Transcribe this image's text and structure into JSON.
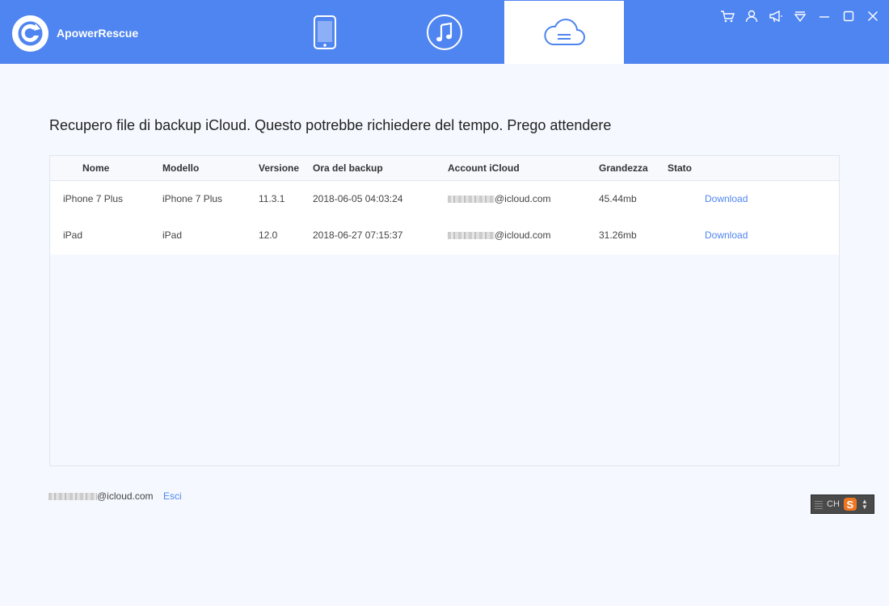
{
  "app": {
    "name": "ApowerRescue"
  },
  "tabs": [
    {
      "id": "device",
      "icon": "tablet-icon",
      "active": false
    },
    {
      "id": "itunes",
      "icon": "music-note-icon",
      "active": false
    },
    {
      "id": "icloud",
      "icon": "cloud-icon",
      "active": true
    }
  ],
  "window_controls": [
    "cart-icon",
    "user-icon",
    "megaphone-icon",
    "dropdown-icon",
    "minimize-icon",
    "maximize-icon",
    "close-icon"
  ],
  "main": {
    "title": "Recupero file di backup iCloud. Questo potrebbe richiedere del tempo. Prego attendere"
  },
  "table": {
    "headers": [
      "Nome",
      "Modello",
      "Versione",
      "Ora del backup",
      "Account iCloud",
      "Grandezza",
      "Stato"
    ],
    "rows": [
      {
        "name": "iPhone 7 Plus",
        "model": "iPhone 7 Plus",
        "version": "11.3.1",
        "backup_time": "2018-06-05 04:03:24",
        "account_suffix": "@icloud.com",
        "size": "45.44mb",
        "action": "Download"
      },
      {
        "name": "iPad",
        "model": "iPad",
        "version": "12.0",
        "backup_time": "2018-06-27 07:15:37",
        "account_suffix": "@icloud.com",
        "size": "31.26mb",
        "action": "Download"
      }
    ]
  },
  "footer": {
    "account_suffix": "@icloud.com",
    "logout_label": "Esci"
  },
  "ime": {
    "label": "CH",
    "logo": "S"
  },
  "colors": {
    "accent": "#4f85f0",
    "background": "#f5f8fe"
  }
}
